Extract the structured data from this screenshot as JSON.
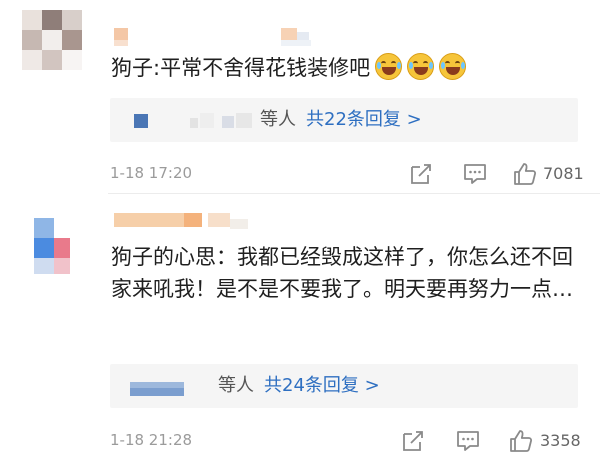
{
  "comments": [
    {
      "text": "狗子:平常不舍得花钱装修吧",
      "emoji_icon": "laughing-with-tears-emoji",
      "emoji_count": 3,
      "reply_summary": {
        "prefix": "等人",
        "link": "共22条回复 >"
      },
      "time": "1-18 17:20",
      "likes": "7081"
    },
    {
      "text": "狗子的心思：我都已经毁成这样了，你怎么还不回家来吼我！是不是不要我了。明天要再努力一点…",
      "reply_summary": {
        "prefix": "等人",
        "link": "共24条回复 >"
      },
      "time": "1-18 21:28",
      "likes": "3358"
    }
  ],
  "colors": {
    "link": "#2e6fc1",
    "meta_text": "#9b9b9b",
    "reply_bg": "#f5f5f5"
  },
  "icons": [
    "share-icon",
    "comment-icon",
    "like-icon"
  ]
}
